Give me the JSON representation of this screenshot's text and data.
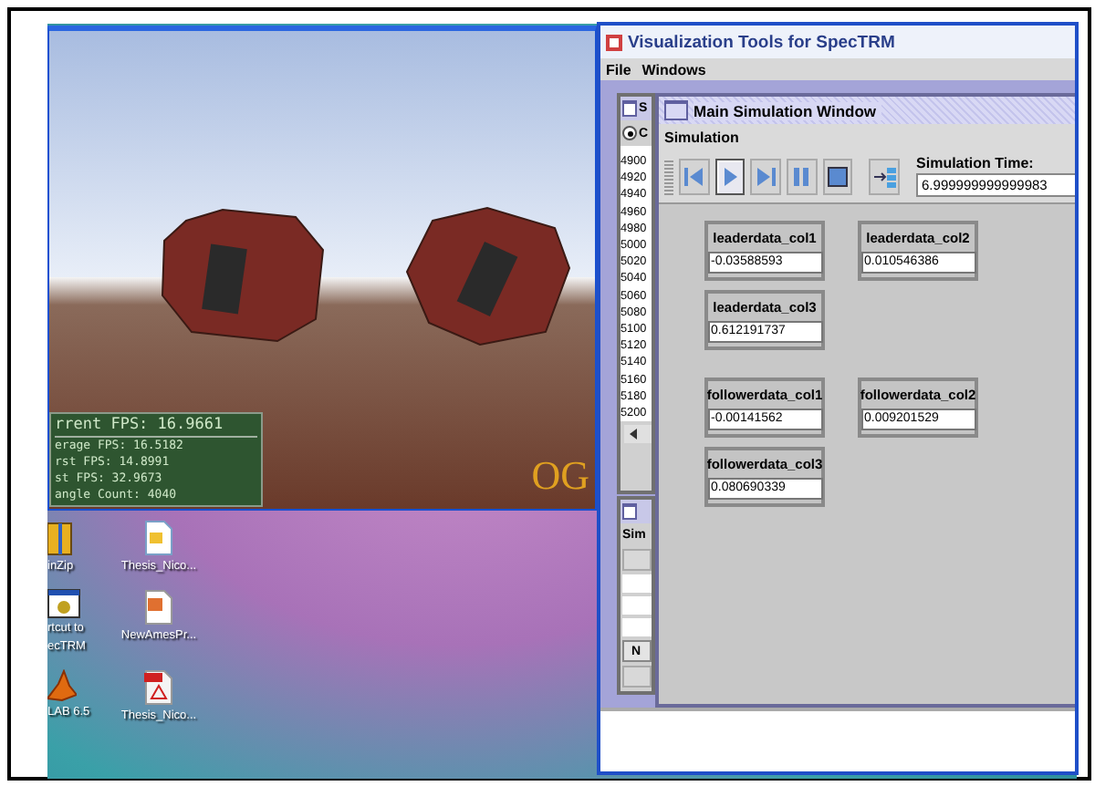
{
  "render_view": {
    "fps_overlay": [
      "rrent FPS: 16.9661",
      "erage FPS: 16.5182",
      "rst FPS: 14.8991",
      "st FPS: 32.9673",
      "angle Count: 4040"
    ],
    "logo": "OG"
  },
  "desktop_icons": [
    {
      "kind": "zip",
      "lines": [
        "inZip"
      ]
    },
    {
      "kind": "document",
      "lines": [
        "Thesis_Nico..."
      ]
    },
    {
      "kind": "shortcut",
      "lines": [
        "rtcut to",
        "ecTRM"
      ]
    },
    {
      "kind": "presentation",
      "lines": [
        "NewAmesPr..."
      ]
    },
    {
      "kind": "matlab",
      "lines": [
        "LAB 6.5"
      ]
    },
    {
      "kind": "pdf",
      "lines": [
        "Thesis_Nico..."
      ]
    }
  ],
  "app_window": {
    "title": "Visualization Tools for SpecTRM",
    "menu": [
      "File",
      "Windows"
    ],
    "back_frame": {
      "title": "S",
      "radio_label": "C",
      "radio_selected": true,
      "list": [
        "4900",
        "4920",
        "4940",
        "4960",
        "4980",
        "5000",
        "5020",
        "5040",
        "5060",
        "5080",
        "5100",
        "5120",
        "5140",
        "5160",
        "5180",
        "5200"
      ]
    },
    "lower_frame": {
      "header": "Sim",
      "button": "N"
    },
    "sim_window": {
      "title": "Main Simulation Window",
      "section": "Simulation",
      "toolbar": [
        {
          "kind": "rewind",
          "selected": false
        },
        {
          "kind": "play",
          "selected": true
        },
        {
          "kind": "step",
          "selected": false
        },
        {
          "kind": "pause",
          "selected": false
        },
        {
          "kind": "stop",
          "selected": false
        }
      ],
      "time_label": "Simulation Time:",
      "time_value": "6.999999999999983",
      "variables": [
        {
          "label": "leaderdata_col1",
          "value": "-0.03588593"
        },
        {
          "label": "leaderdata_col2",
          "value": "0.010546386"
        },
        {
          "label": "leaderdata_col3",
          "value": "0.612191737"
        },
        {
          "label": "followerdata_col1",
          "value": "-0.00141562"
        },
        {
          "label": "followerdata_col2",
          "value": "0.009201529"
        },
        {
          "label": "followerdata_col3",
          "value": "0.080690339"
        }
      ]
    }
  }
}
